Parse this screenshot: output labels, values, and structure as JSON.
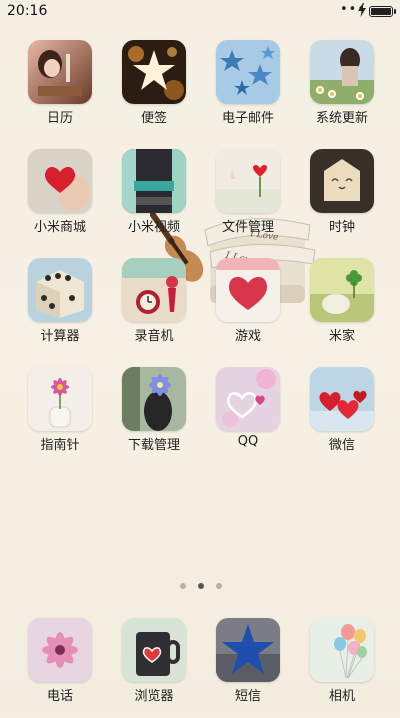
{
  "status_bar": {
    "time": "20:16",
    "battery_level": 0.9
  },
  "apps": [
    {
      "label": "日历"
    },
    {
      "label": "便签"
    },
    {
      "label": "电子邮件"
    },
    {
      "label": "系统更新"
    },
    {
      "label": "小米商城"
    },
    {
      "label": "小米视频"
    },
    {
      "label": "文件管理"
    },
    {
      "label": "时钟"
    },
    {
      "label": "计算器"
    },
    {
      "label": "录音机"
    },
    {
      "label": "游戏"
    },
    {
      "label": "米家"
    },
    {
      "label": "指南针"
    },
    {
      "label": "下载管理"
    },
    {
      "label": "QQ"
    },
    {
      "label": "微信"
    }
  ],
  "dock": [
    {
      "label": "电话"
    },
    {
      "label": "浏览器"
    },
    {
      "label": "短信"
    },
    {
      "label": "相机"
    }
  ],
  "pager": {
    "pages": 3,
    "current": 2
  },
  "wallpaper_text": {
    "line1": "I Love You",
    "line2": "I Love"
  }
}
